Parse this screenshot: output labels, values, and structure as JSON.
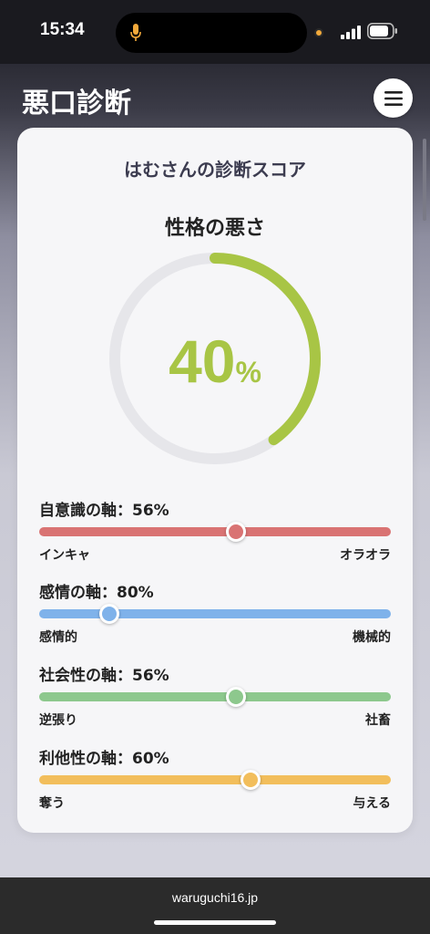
{
  "status_bar": {
    "time": "15:34"
  },
  "header": {
    "title": "悪口診断"
  },
  "card": {
    "title": "はむさんの診断スコア",
    "score_label": "性格の悪さ",
    "score_value": "40",
    "score_unit": "%",
    "score_fraction": 0.4,
    "gauge_color": "#a8c545",
    "track_color": "#e6e6ea"
  },
  "axes": [
    {
      "label": "自意識の軸：56%",
      "value": 0.56,
      "left": "インキャ",
      "right": "オラオラ",
      "color": "#d97373"
    },
    {
      "label": "感情の軸：80%",
      "value": 0.2,
      "left": "感情的",
      "right": "機械的",
      "color": "#7fb2ea"
    },
    {
      "label": "社会性の軸：56%",
      "value": 0.56,
      "left": "逆張り",
      "right": "社畜",
      "color": "#8dc88d"
    },
    {
      "label": "利他性の軸：60%",
      "value": 0.6,
      "left": "奪う",
      "right": "与える",
      "color": "#f2be5c"
    }
  ],
  "bottom_bar": {
    "url": "waruguchi16.jp"
  },
  "icons": {
    "menu": "hamburger-menu-icon",
    "mic": "microphone-icon",
    "signal": "cellular-signal-icon",
    "battery": "battery-icon"
  }
}
